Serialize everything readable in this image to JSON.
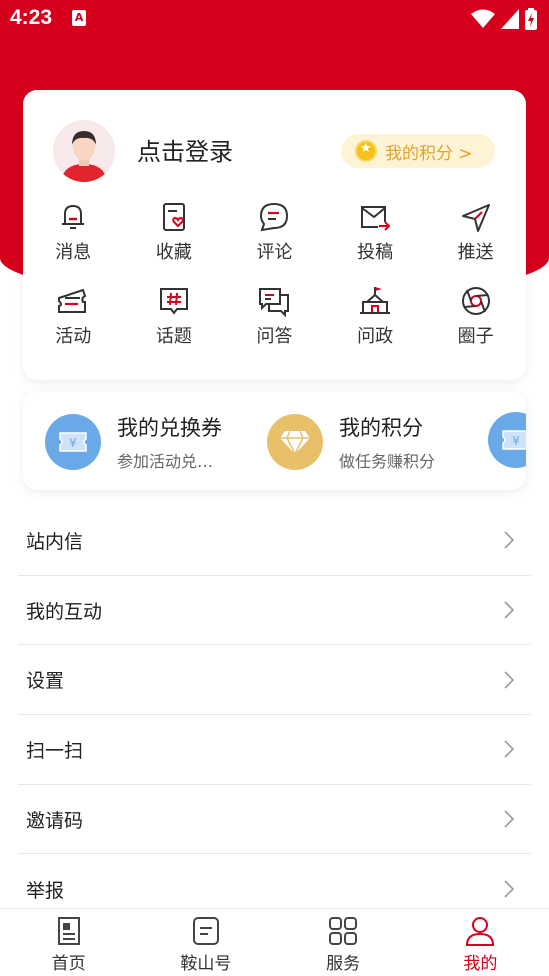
{
  "status_bar": {
    "time": "4:23",
    "sim_label": "A"
  },
  "profile": {
    "login_label": "点击登录",
    "points_label": "我的积分 >"
  },
  "grid": [
    [
      {
        "label": "消息",
        "icon": "bell-icon"
      },
      {
        "label": "收藏",
        "icon": "favorite-icon"
      },
      {
        "label": "评论",
        "icon": "comment-icon"
      },
      {
        "label": "投稿",
        "icon": "submit-mail-icon"
      },
      {
        "label": "推送",
        "icon": "send-icon"
      }
    ],
    [
      {
        "label": "活动",
        "icon": "ticket-icon"
      },
      {
        "label": "话题",
        "icon": "topic-hash-icon"
      },
      {
        "label": "问答",
        "icon": "qa-icon"
      },
      {
        "label": "问政",
        "icon": "government-icon"
      },
      {
        "label": "圈子",
        "icon": "circle-aperture-icon"
      }
    ]
  ],
  "strip": [
    {
      "title": "我的兑换券",
      "subtitle": "参加活动兑…",
      "icon": "coupon-icon",
      "color": "#6aa9e8"
    },
    {
      "title": "我的积分",
      "subtitle": "做任务赚积分",
      "icon": "diamond-icon",
      "color": "#e8c06a"
    }
  ],
  "menu": [
    {
      "label": "站内信"
    },
    {
      "label": "我的互动"
    },
    {
      "label": "设置"
    },
    {
      "label": "扫一扫"
    },
    {
      "label": "邀请码"
    },
    {
      "label": "举报"
    }
  ],
  "bottom_nav": [
    {
      "label": "首页",
      "icon": "home-news-icon"
    },
    {
      "label": "鞍山号",
      "icon": "document-icon"
    },
    {
      "label": "服务",
      "icon": "grid-squares-icon"
    },
    {
      "label": "我的",
      "icon": "person-icon",
      "active": true
    }
  ],
  "colors": {
    "brand_red": "#d6001c",
    "points_gold": "#e0a32a"
  }
}
